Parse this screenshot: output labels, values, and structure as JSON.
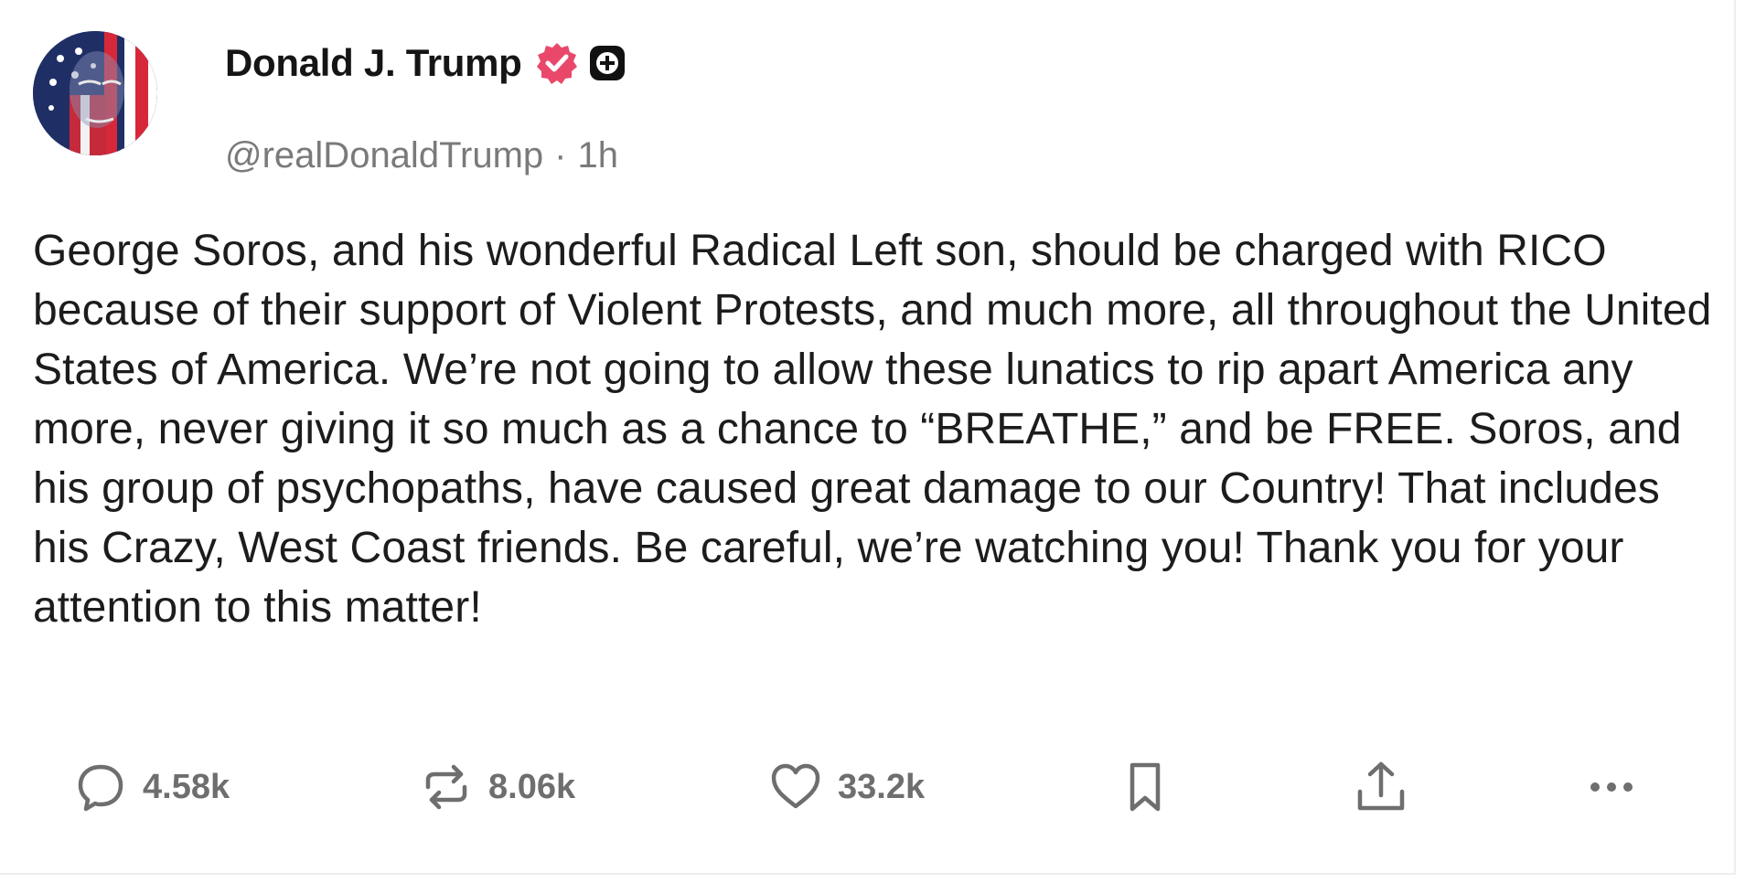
{
  "post": {
    "author": {
      "display_name": "Donald J. Trump",
      "handle": "@realDonaldTrump",
      "time_ago": "1h",
      "separator": "·"
    },
    "text": "George Soros, and his wonderful Radical Left son, should be charged with RICO because of their support of Violent Protests, and much more, all throughout the United States of America. We’re not going to allow these lunatics to rip apart America any more, never giving it so much as a chance to “BREATHE,” and be FREE. Soros, and his group of psychopaths, have caused great damage to our Country! That includes his Crazy, West Coast friends. Be careful, we’re watching you! Thank you for your attention to this matter!",
    "actions": {
      "replies": "4.58k",
      "retruths": "8.06k",
      "likes": "33.2k"
    }
  },
  "icons": {
    "avatar": "flag-portrait-avatar",
    "verified": "verified-badge-icon",
    "plus": "plus-badge-icon",
    "reply": "reply-bubble-icon",
    "retruth": "retruth-arrows-icon",
    "like": "heart-icon",
    "save": "bookmark-icon",
    "share": "share-upload-icon",
    "more": "more-dots-icon"
  },
  "colors": {
    "verified_badge": "#e9486a",
    "text": "#1c1c1c",
    "muted": "#7a7a7a",
    "icon": "#6e6e6e"
  }
}
